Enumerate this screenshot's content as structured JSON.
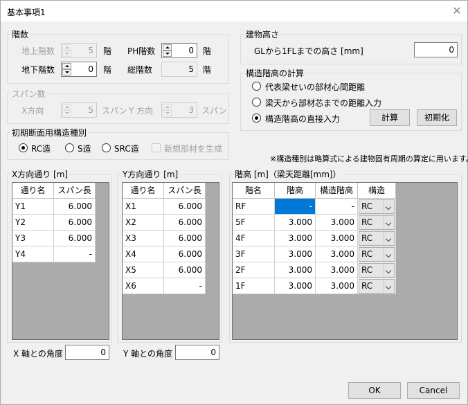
{
  "window": {
    "title": "基本事項1",
    "close": "✕"
  },
  "floors": {
    "label": "階数",
    "above_label": "地上階数",
    "above_value": "5",
    "below_label": "地下階数",
    "below_value": "0",
    "ph_label": "PH階数",
    "ph_value": "0",
    "total_label": "総階数",
    "total_value": "5",
    "unit": "階"
  },
  "span": {
    "label": "スパン数",
    "x_label": "X方向",
    "x_value": "5",
    "y_label": "Y 方向",
    "y_value": "3",
    "unit": "スパン"
  },
  "section": {
    "label": "初期断面用構造種別",
    "options": [
      "RC造",
      "S造",
      "SRC造"
    ],
    "selected": "RC造",
    "new_member_label": "新規部材を生成"
  },
  "building_height": {
    "label": "建物高さ",
    "field_label": "GLから1FLまでの高さ [mm]",
    "value": "0"
  },
  "story_calc": {
    "label": "構造階高の計算",
    "options": [
      "代表梁せいの部材心間距離",
      "梁天から部材芯までの距離入力",
      "構造階高の直接入力"
    ],
    "selected": "構造階高の直接入力",
    "calc_button": "計算",
    "init_button": "初期化"
  },
  "note": "※構造種別は略算式による建物固有周期の算定に用います。",
  "x_grid": {
    "label": "X方向通り [m]",
    "headers": [
      "通り名",
      "スパン長"
    ],
    "rows": [
      [
        "Y1",
        "6.000"
      ],
      [
        "Y2",
        "6.000"
      ],
      [
        "Y3",
        "6.000"
      ],
      [
        "Y4",
        "-"
      ]
    ],
    "angle_label": "X 軸との角度",
    "angle_value": "0"
  },
  "y_grid": {
    "label": "Y方向通り [m]",
    "headers": [
      "通り名",
      "スパン長"
    ],
    "rows": [
      [
        "X1",
        "6.000"
      ],
      [
        "X2",
        "6.000"
      ],
      [
        "X3",
        "6.000"
      ],
      [
        "X4",
        "6.000"
      ],
      [
        "X5",
        "6.000"
      ],
      [
        "X6",
        "-"
      ]
    ],
    "angle_label": "Y 軸との角度",
    "angle_value": "0"
  },
  "story_table": {
    "label": "階高 [m]（梁天距離[mm]）",
    "headers": [
      "階名",
      "階高",
      "構造階高",
      "構造"
    ],
    "rows": [
      [
        "RF",
        "-",
        "-",
        "RC"
      ],
      [
        "5F",
        "3.000",
        "3.000",
        "RC"
      ],
      [
        "4F",
        "3.000",
        "3.000",
        "RC"
      ],
      [
        "3F",
        "3.000",
        "3.000",
        "RC"
      ],
      [
        "2F",
        "3.000",
        "3.000",
        "RC"
      ],
      [
        "1F",
        "3.000",
        "3.000",
        "RC"
      ]
    ]
  },
  "buttons": {
    "ok": "OK",
    "cancel": "Cancel"
  },
  "colors": {
    "selection": "#0078d7",
    "grid_background": "#ababab"
  }
}
